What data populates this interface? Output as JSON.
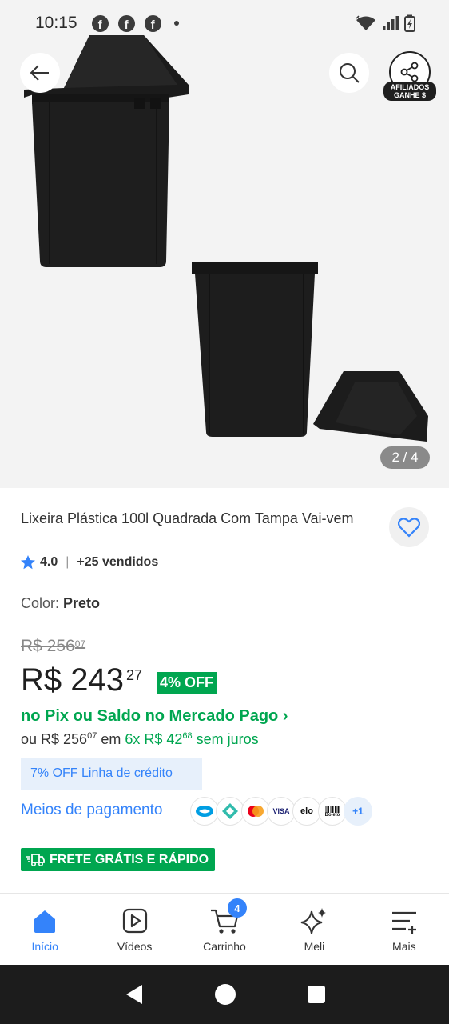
{
  "status_bar": {
    "time": "10:15"
  },
  "gallery": {
    "pager": "2 / 4"
  },
  "affiliate": {
    "line1": "AFILIADOS",
    "line2": "GANHE $"
  },
  "product": {
    "title": "Lixeira Plástica 100l Quadrada Com Tampa Vai-vem",
    "rating": "4.0",
    "sold": "+25 vendidos",
    "color_label": "Color:",
    "color_value": "Preto",
    "old_price_main": "R$ 256",
    "old_price_cents": "07",
    "price_main": "R$ 243",
    "price_cents": "27",
    "discount": "4% OFF",
    "pix_text": "no Pix ou Saldo no Mercado Pago ›",
    "install_prefix": "ou R$ 256",
    "install_prefix_cents": "07",
    "install_em": " em ",
    "install_main": "6x R$ 42",
    "install_cents": "68",
    "install_suffix": " sem juros",
    "credit_chip": "7% OFF Linha de crédito",
    "payment_methods_label": "Meios de pagamento",
    "payment_more": "+1",
    "shipping": "FRETE GRÁTIS E RÁPIDO"
  },
  "payment_icons": [
    "mercado-pago-icon",
    "pix-icon",
    "mastercard-icon",
    "visa-icon",
    "elo-icon",
    "boleto-icon"
  ],
  "payment_icon_labels": {
    "visa": "VISA",
    "elo": "elo",
    "boleto": "Boleto"
  },
  "bottom_nav": {
    "items": [
      {
        "label": "Início"
      },
      {
        "label": "Vídeos"
      },
      {
        "label": "Carrinho"
      },
      {
        "label": "Meli"
      },
      {
        "label": "Mais"
      }
    ],
    "cart_count": "4"
  },
  "colors": {
    "accent": "#3483fa",
    "green": "#00a650"
  }
}
